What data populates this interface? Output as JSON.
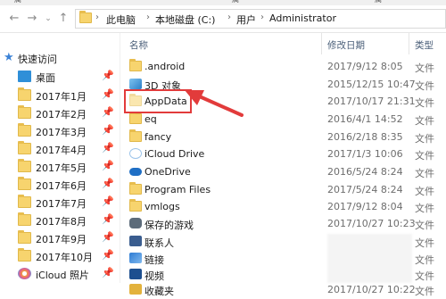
{
  "ribbon": {
    "labels": [
      "属",
      "属",
      "属"
    ]
  },
  "nav": {
    "back_icon": "back-arrow-icon",
    "forward_icon": "forward-arrow-icon",
    "history_icon": "chevron-down-icon",
    "up_icon": "up-arrow-icon"
  },
  "address": {
    "crumbs": [
      "此电脑",
      "本地磁盘 (C:)",
      "用户",
      "Administrator"
    ]
  },
  "sidebar": {
    "quick_access": "快速访问",
    "items": [
      {
        "label": "桌面",
        "icon": "desktop-folder-icon"
      },
      {
        "label": "2017年1月",
        "icon": "folder-icon"
      },
      {
        "label": "2017年2月",
        "icon": "folder-icon"
      },
      {
        "label": "2017年3月",
        "icon": "folder-icon"
      },
      {
        "label": "2017年4月",
        "icon": "folder-icon"
      },
      {
        "label": "2017年5月",
        "icon": "folder-icon"
      },
      {
        "label": "2017年6月",
        "icon": "folder-icon"
      },
      {
        "label": "2017年7月",
        "icon": "folder-icon"
      },
      {
        "label": "2017年8月",
        "icon": "folder-icon"
      },
      {
        "label": "2017年9月",
        "icon": "folder-icon"
      },
      {
        "label": "2017年10月",
        "icon": "folder-icon"
      },
      {
        "label": "iCloud 照片",
        "icon": "icloud-photos-icon"
      }
    ]
  },
  "columns": {
    "name": "名称",
    "date": "修改日期",
    "type": "类型"
  },
  "files": [
    {
      "name": ".android",
      "date": "2017/9/12 8:05",
      "type": "文件",
      "icon": "folder-icon"
    },
    {
      "name": "3D 对象",
      "date": "2015/12/15 10:47",
      "type": "文件",
      "icon": "3d-objects-icon"
    },
    {
      "name": "AppData",
      "date": "2017/10/17 21:31",
      "type": "文件",
      "icon": "folder-icon"
    },
    {
      "name": "eq",
      "date": "2016/4/1 14:52",
      "type": "文件",
      "icon": "folder-icon"
    },
    {
      "name": "fancy",
      "date": "2016/2/18 8:35",
      "type": "文件",
      "icon": "folder-icon"
    },
    {
      "name": "iCloud Drive",
      "date": "2017/1/3 10:06",
      "type": "文件",
      "icon": "icloud-drive-icon"
    },
    {
      "name": "OneDrive",
      "date": "2016/5/24 8:24",
      "type": "文件",
      "icon": "onedrive-icon"
    },
    {
      "name": "Program Files",
      "date": "2017/5/24 8:24",
      "type": "文件",
      "icon": "folder-icon"
    },
    {
      "name": "vmlogs",
      "date": "2017/9/12 8:04",
      "type": "文件",
      "icon": "folder-icon"
    },
    {
      "name": "保存的游戏",
      "date": "2017/10/27 10:23",
      "type": "文件",
      "icon": "saved-games-icon"
    },
    {
      "name": "联系人",
      "date": "",
      "type": "文件",
      "icon": "contacts-icon"
    },
    {
      "name": "链接",
      "date": "",
      "type": "文件",
      "icon": "links-icon"
    },
    {
      "name": "视频",
      "date": "",
      "type": "文件",
      "icon": "videos-icon"
    },
    {
      "name": "收藏夹",
      "date": "2017/10/27 10:22",
      "type": "文件",
      "icon": "favorites-icon"
    }
  ],
  "annotation": {
    "color": "#e23b3b"
  }
}
